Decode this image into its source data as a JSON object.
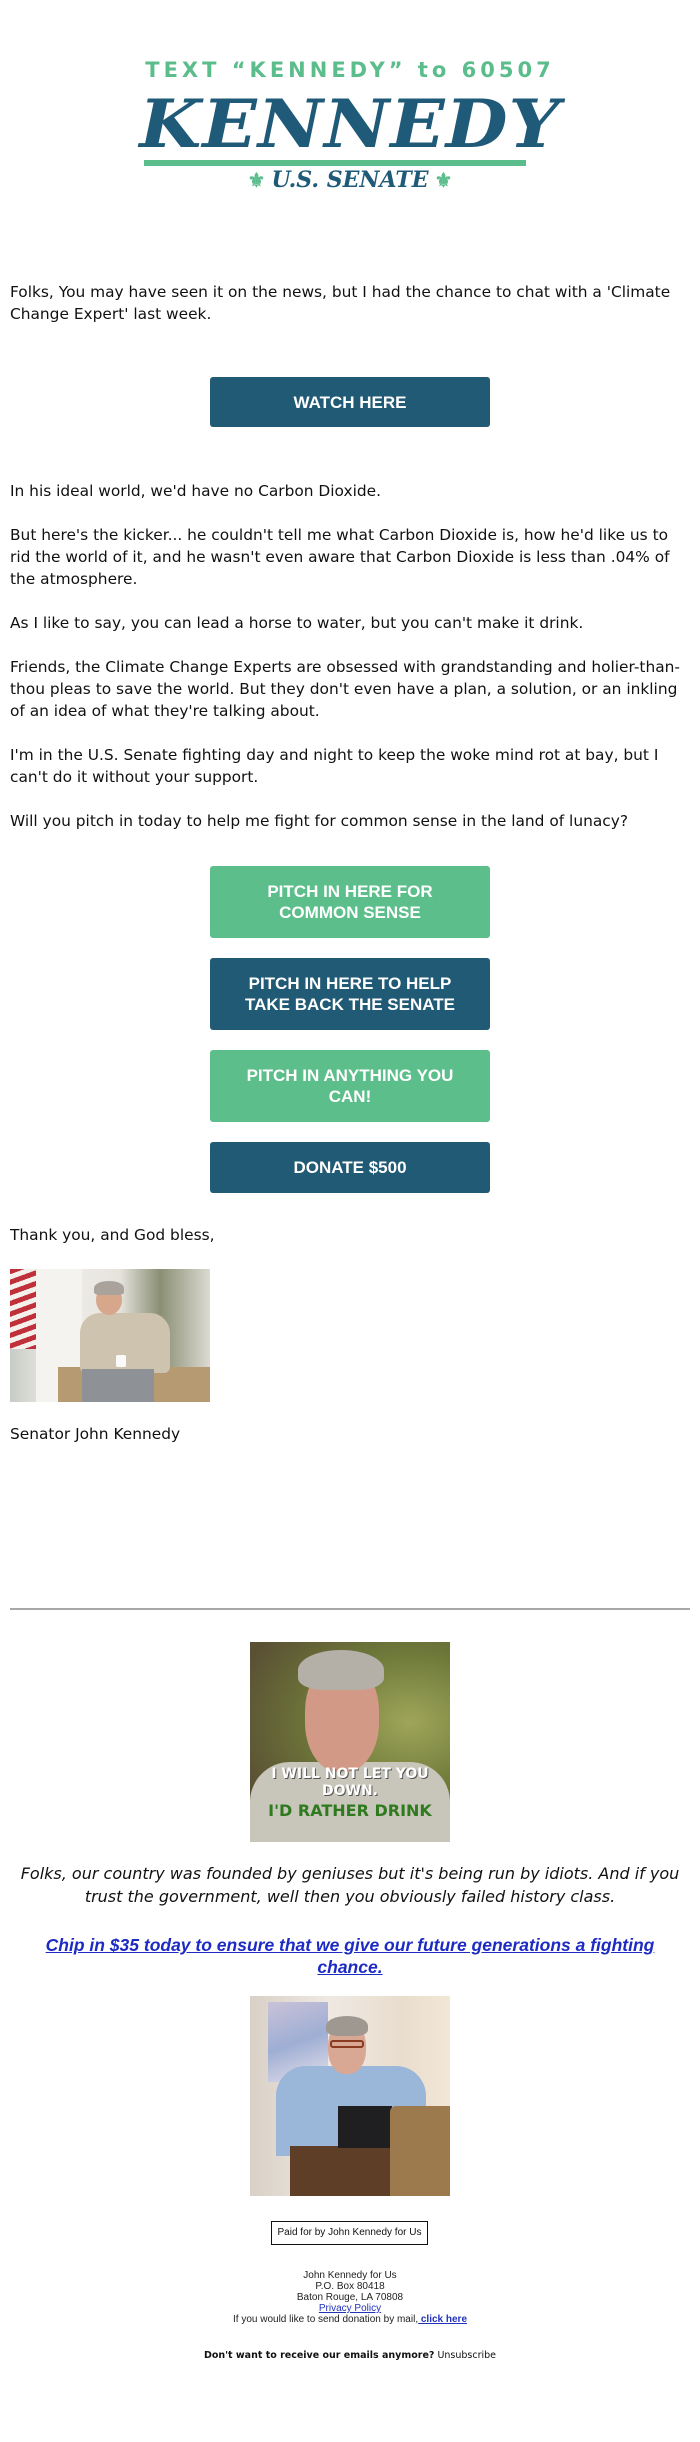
{
  "logo": {
    "text_line": "TEXT “KENNEDY” to 60507",
    "name": "KENNEDY",
    "office": "U.S. SENATE",
    "fleur_icon": "⚜"
  },
  "intro": "Folks, You may have seen it on the news, but I had the chance to chat with a 'Climate Change Expert' last week.",
  "watch_button": "WATCH HERE",
  "paragraphs": [
    "In his ideal world, we'd have no Carbon Dioxide.",
    "But here's the kicker... he couldn't tell me what Carbon Dioxide is, how he'd like us to rid the world of it, and he wasn't even aware that Carbon Dioxide is less than .04% of the atmosphere.",
    "As I like to say, you can lead a horse to water, but you can't make it drink.",
    "Friends, the Climate Change Experts are obsessed with grandstanding and holier-than-thou pleas to save the world. But they don't even have a plan, a solution, or an inkling of an idea of what they're talking about.",
    "I'm in the U.S. Senate fighting day and night to keep the woke mind rot at bay, but I can't do it without your support.",
    "Will you pitch in today to help me fight for common sense in the land of lunacy?"
  ],
  "donate_buttons": [
    {
      "label": "PITCH IN HERE FOR COMMON SENSE",
      "color": "#5cbf8b"
    },
    {
      "label": "PITCH IN HERE TO HELP TAKE BACK THE SENATE",
      "color": "#205a75"
    },
    {
      "label": "PITCH IN ANYTHING YOU CAN!",
      "color": "#5cbf8b"
    },
    {
      "label": "DONATE $500",
      "color": "#205a75"
    }
  ],
  "signoff": "Thank you, and God bless,",
  "signature": "Senator John Kennedy",
  "meme": {
    "caption_white": "I WILL NOT LET YOU DOWN.",
    "caption_green": "I'D RATHER DRINK"
  },
  "quote": "Folks, our country was founded by geniuses but it's being run by idiots. And if you trust the government, well then you obviously failed history class.",
  "chip_link": "Chip in $35 today to ensure that we give our future generations a fighting chance.",
  "footer": {
    "paid_for": "Paid for by John Kennedy for Us",
    "org": "John Kennedy for Us",
    "po_box": "P.O. Box 80418",
    "city": "Baton Rouge, LA 70808",
    "privacy": "Privacy Policy",
    "mail_text": "If you would like to send donation by mail,",
    "mail_link": " click here",
    "unsub_question": "Don't want to receive our emails anymore?",
    "unsub_link": "Unsubscribe"
  },
  "colors": {
    "brand_blue": "#1f5a78",
    "brand_green": "#5cbd8c",
    "link_blue": "#1d2bc2"
  }
}
